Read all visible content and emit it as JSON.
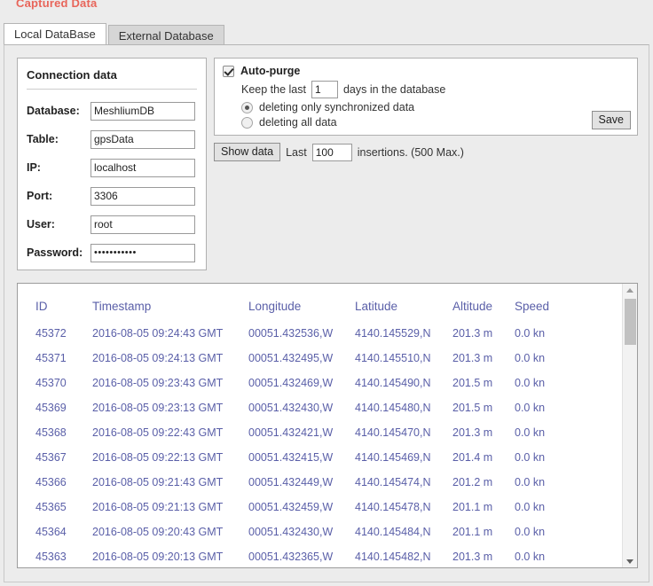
{
  "page": {
    "title": "Captured Data",
    "title_color": "#e8655a"
  },
  "tabs": [
    {
      "label": "Local DataBase",
      "active": true
    },
    {
      "label": "External Database",
      "active": false
    }
  ],
  "connection": {
    "title": "Connection data",
    "fields": [
      {
        "label": "Database:",
        "value": "MeshliumDB",
        "name": "database-field"
      },
      {
        "label": "Table:",
        "value": "gpsData",
        "name": "table-field"
      },
      {
        "label": "IP:",
        "value": "localhost",
        "name": "ip-field"
      },
      {
        "label": "Port:",
        "value": "3306",
        "name": "port-field"
      },
      {
        "label": "User:",
        "value": "root",
        "name": "user-field"
      },
      {
        "label": "Password:",
        "value": "•••••••••••",
        "name": "password-field"
      }
    ]
  },
  "autopurge": {
    "checkbox_label": "Auto-purge",
    "checked": true,
    "keep_prefix": "Keep the last",
    "days_value": "1",
    "keep_suffix": "days in the database",
    "options": [
      {
        "label": "deleting only synchronized data",
        "selected": true
      },
      {
        "label": "deleting all data",
        "selected": false
      }
    ],
    "save_label": "Save"
  },
  "showdata": {
    "button_label": "Show data",
    "last_label": "Last",
    "last_value": "100",
    "suffix": "insertions. (500 Max.)"
  },
  "table": {
    "columns": [
      "ID",
      "Timestamp",
      "Longitude",
      "Latitude",
      "Altitude",
      "Speed"
    ],
    "rows": [
      [
        "45372",
        "2016-08-05 09:24:43 GMT",
        "00051.432536,W",
        "4140.145529,N",
        "201.3 m",
        "0.0 kn"
      ],
      [
        "45371",
        "2016-08-05 09:24:13 GMT",
        "00051.432495,W",
        "4140.145510,N",
        "201.3 m",
        "0.0 kn"
      ],
      [
        "45370",
        "2016-08-05 09:23:43 GMT",
        "00051.432469,W",
        "4140.145490,N",
        "201.5 m",
        "0.0 kn"
      ],
      [
        "45369",
        "2016-08-05 09:23:13 GMT",
        "00051.432430,W",
        "4140.145480,N",
        "201.5 m",
        "0.0 kn"
      ],
      [
        "45368",
        "2016-08-05 09:22:43 GMT",
        "00051.432421,W",
        "4140.145470,N",
        "201.3 m",
        "0.0 kn"
      ],
      [
        "45367",
        "2016-08-05 09:22:13 GMT",
        "00051.432415,W",
        "4140.145469,N",
        "201.4 m",
        "0.0 kn"
      ],
      [
        "45366",
        "2016-08-05 09:21:43 GMT",
        "00051.432449,W",
        "4140.145474,N",
        "201.2 m",
        "0.0 kn"
      ],
      [
        "45365",
        "2016-08-05 09:21:13 GMT",
        "00051.432459,W",
        "4140.145478,N",
        "201.1 m",
        "0.0 kn"
      ],
      [
        "45364",
        "2016-08-05 09:20:43 GMT",
        "00051.432430,W",
        "4140.145484,N",
        "201.1 m",
        "0.0 kn"
      ],
      [
        "45363",
        "2016-08-05 09:20:13 GMT",
        "00051.432365,W",
        "4140.145482,N",
        "201.3 m",
        "0.0 kn"
      ]
    ]
  }
}
